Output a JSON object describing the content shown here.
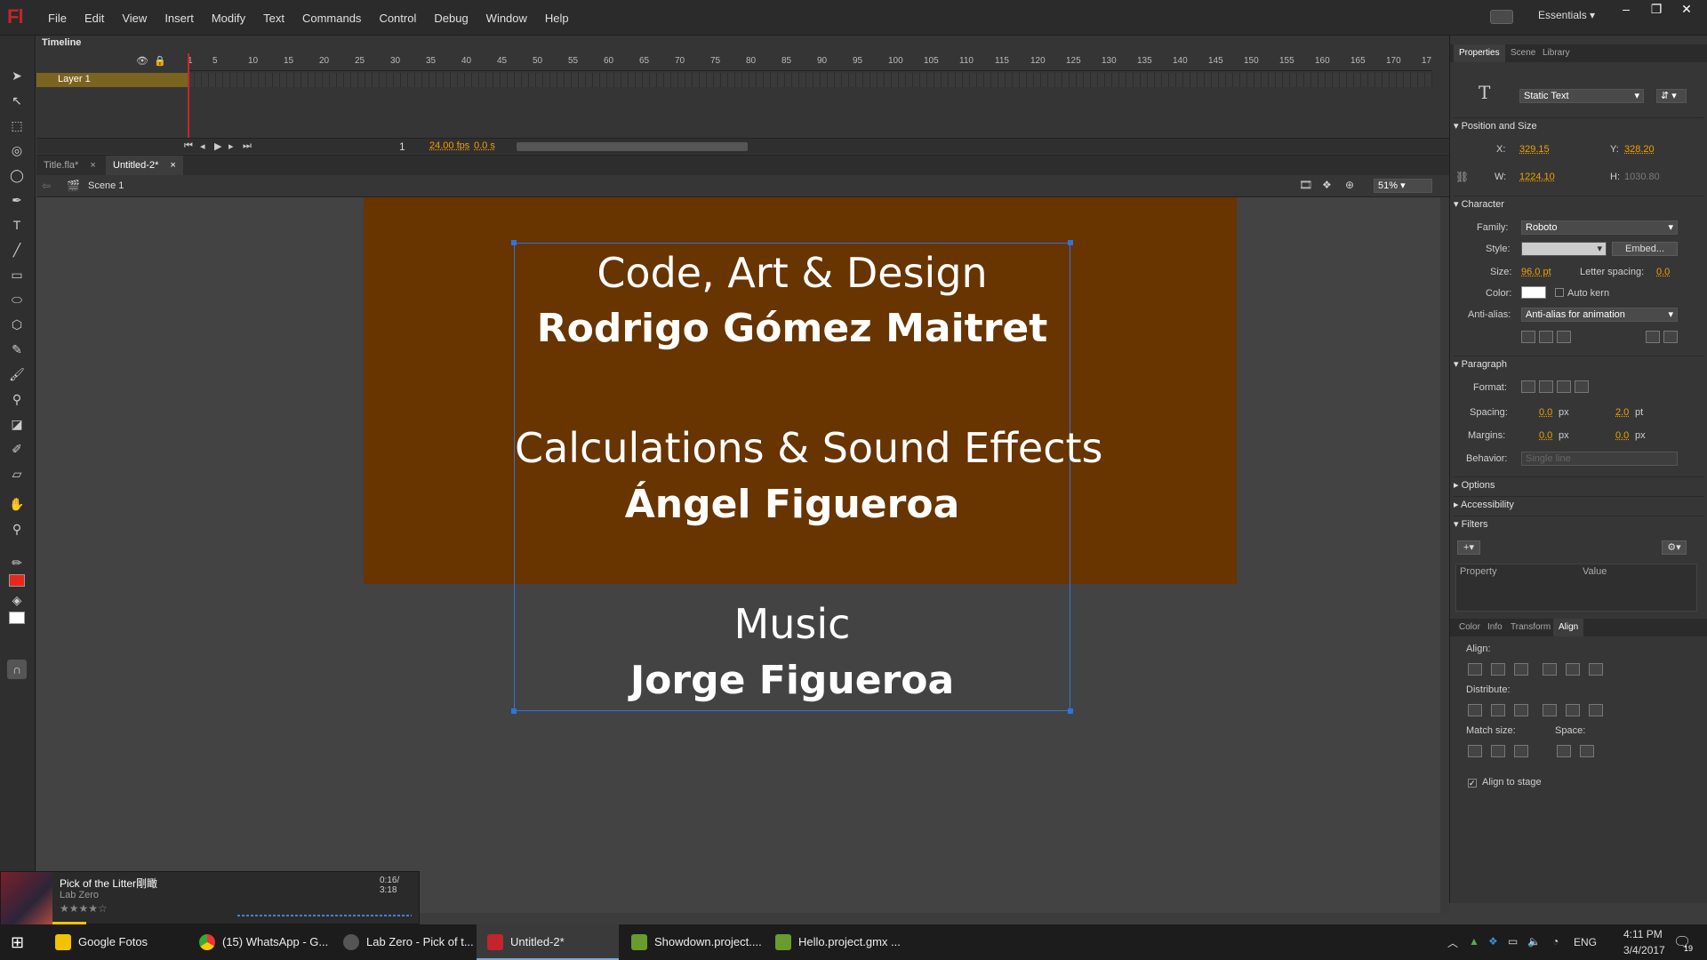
{
  "app": {
    "logo": "Fl",
    "workspace": "Essentials"
  },
  "menu": [
    "File",
    "Edit",
    "View",
    "Insert",
    "Modify",
    "Text",
    "Commands",
    "Control",
    "Debug",
    "Window",
    "Help"
  ],
  "timeline": {
    "title": "Timeline",
    "layer_name": "Layer 1",
    "ruler": [
      "1",
      "5",
      "10",
      "15",
      "20",
      "25",
      "30",
      "35",
      "40",
      "45",
      "50",
      "55",
      "60",
      "65",
      "70",
      "75",
      "80",
      "85",
      "90",
      "95",
      "100",
      "105",
      "110",
      "115",
      "120",
      "125",
      "130",
      "135",
      "140",
      "145",
      "150",
      "155",
      "160",
      "165",
      "170",
      "17"
    ],
    "current_frame": "1",
    "fps": "24.00 fps",
    "time": "0.0 s"
  },
  "doc_tabs": [
    {
      "label": "Title.fla*"
    },
    {
      "label": "Untitled-2*"
    }
  ],
  "editbar": {
    "scene": "Scene 1",
    "zoom": "51%"
  },
  "stage_text": {
    "l1": "Code, Art & Design",
    "l2": "Rodrigo Gómez Maitret",
    "l3": "Calculations & Sound Effects",
    "l4": "Ángel Figueroa",
    "l5": "Music",
    "l6": "Jorge Figueroa"
  },
  "properties": {
    "tabs": [
      "Properties",
      "Scene",
      "Library"
    ],
    "text_type": "Static Text",
    "pos_size": {
      "title": "Position and Size",
      "x_label": "X:",
      "x": "329.15",
      "y_label": "Y:",
      "y": "328.20",
      "w_label": "W:",
      "w": "1224.10",
      "h_label": "H:",
      "h": "1030.80"
    },
    "character": {
      "title": "Character",
      "family_label": "Family:",
      "family": "Roboto",
      "style_label": "Style:",
      "embed": "Embed...",
      "size_label": "Size:",
      "size": "96.0 pt",
      "ls_label": "Letter spacing:",
      "ls": "0.0",
      "color_label": "Color:",
      "autokern": "Auto kern",
      "aa_label": "Anti-alias:",
      "aa": "Anti-alias for animation"
    },
    "paragraph": {
      "title": "Paragraph",
      "format_label": "Format:",
      "spacing_label": "Spacing:",
      "sp1": "0.0",
      "sp1u": "px",
      "sp2": "2.0",
      "sp2u": "pt",
      "margins_label": "Margins:",
      "m1": "0.0",
      "m1u": "px",
      "m2": "0.0",
      "m2u": "px",
      "behavior_label": "Behavior:",
      "behavior": "Single line"
    },
    "options": "Options",
    "accessibility": "Accessibility",
    "filters": "Filters",
    "filter_cols": [
      "Property",
      "Value"
    ]
  },
  "align_panel": {
    "tabs": [
      "Color",
      "Info",
      "Transform",
      "Align"
    ],
    "align": "Align:",
    "distribute": "Distribute:",
    "match": "Match size:",
    "space": "Space:",
    "stage": "Align to stage"
  },
  "music": {
    "title": "Pick of the Litter剛瞰",
    "artist": "Lab Zero",
    "time": "0:16/ 3:18",
    "rating": 4
  },
  "taskbar": {
    "items": [
      "Google Fotos",
      "(15) WhatsApp - G...",
      "Lab Zero - Pick of t...",
      "Untitled-2*",
      "Showdown.project....",
      "Hello.project.gmx ..."
    ],
    "lang": "ENG",
    "time": "4:11 PM",
    "date": "3/4/2017",
    "notif": "19"
  },
  "colors": {
    "stage": "#683400",
    "accent": "#f0a000",
    "logo": "#c2252d",
    "selection": "#2d74e0"
  }
}
